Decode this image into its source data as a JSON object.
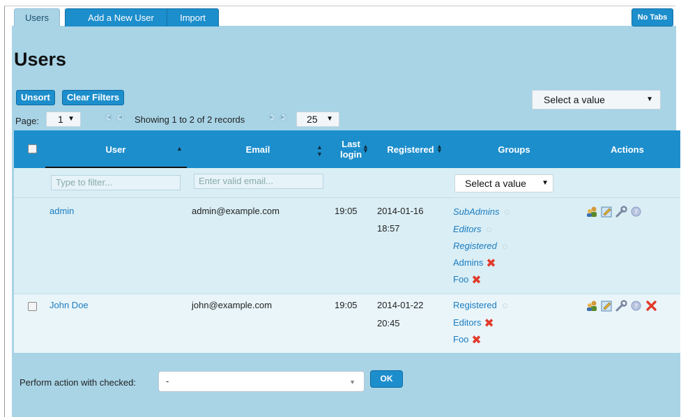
{
  "tabs": [
    {
      "label": "Users"
    },
    {
      "label": "Add a New User"
    },
    {
      "label": "Import"
    }
  ],
  "notabs_label": "No Tabs",
  "page_title": "Users",
  "toolbar": {
    "unsort_label": "Unsort",
    "clear_filters_label": "Clear Filters",
    "top_select_value": "Select a value"
  },
  "pager": {
    "page_label": "Page:",
    "page_value": "1",
    "showing_text": "Showing 1 to 2 of 2 records",
    "per_page_value": "25"
  },
  "table": {
    "columns": {
      "user": "User",
      "email": "Email",
      "last_login_1": "Last",
      "last_login_2": "login",
      "registered": "Registered",
      "groups": "Groups",
      "actions": "Actions"
    },
    "filters": {
      "user_placeholder": "Type to filter...",
      "email_placeholder": "Enter valid email...",
      "groups_select_value": "Select a value"
    },
    "rows": [
      {
        "user": "admin",
        "email": "admin@example.com",
        "last_login": "19:05",
        "registered_date": "2014-01-16",
        "registered_time": "18:57",
        "groups": [
          "SubAdmins",
          "Editors",
          "Registered",
          "Admins",
          "Foo"
        ]
      },
      {
        "user": "John Doe",
        "email": "john@example.com",
        "last_login": "19:05",
        "registered_date": "2014-01-22",
        "registered_time": "20:45",
        "groups": [
          "Registered",
          "Editors",
          "Foo"
        ]
      }
    ]
  },
  "footer": {
    "perform_label": "Perform action with checked:",
    "perform_value": "-",
    "ok_label": "OK"
  },
  "colors": {
    "accent": "#1d8ecc",
    "panel": "#a8d4e6",
    "row": "#daeef5",
    "link": "#1a7cc0",
    "remove": "#e23b2a"
  },
  "icons": [
    "login-as-icon",
    "edit-icon",
    "wrench-icon",
    "help-icon",
    "delete-icon"
  ]
}
